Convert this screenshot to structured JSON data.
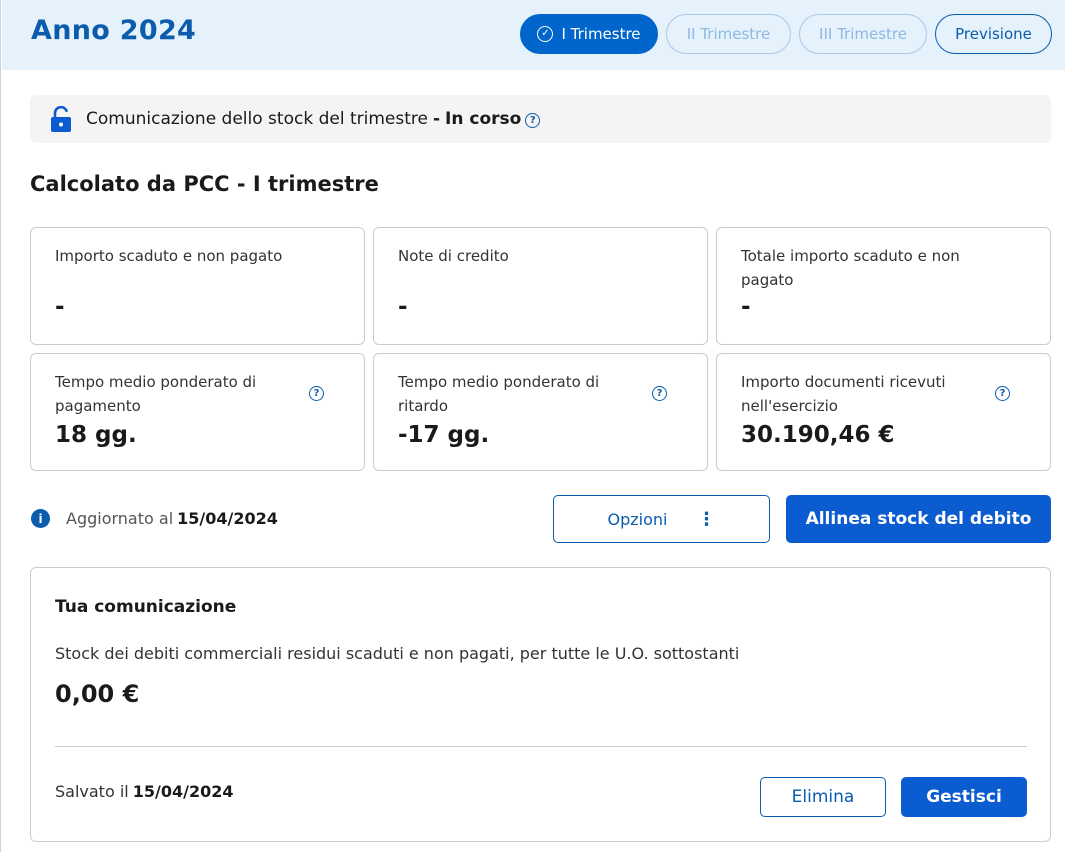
{
  "header": {
    "title": "Anno 2024",
    "tabs": [
      {
        "label": "I Trimestre",
        "state": "active"
      },
      {
        "label": "II Trimestre",
        "state": "disabled"
      },
      {
        "label": "III Trimestre",
        "state": "disabled"
      },
      {
        "label": "Previsione",
        "state": "enabled"
      }
    ]
  },
  "status": {
    "label": "Comunicazione dello stock del trimestre",
    "separator": "-",
    "value": "In corso",
    "lock_icon": "lock-open-icon",
    "help_icon": "?"
  },
  "section": {
    "title": "Calcolato da PCC - I trimestre"
  },
  "cards": [
    {
      "label": "Importo scaduto e non pagato",
      "value": "-"
    },
    {
      "label": "Note di credito",
      "value": "-"
    },
    {
      "label": "Totale importo scaduto e non pagato",
      "value": "-"
    },
    {
      "label": "Tempo medio ponderato di pagamento",
      "value": "18 gg.",
      "help": "?"
    },
    {
      "label": "Tempo medio ponderato di ritardo",
      "value": "-17 gg.",
      "help": "?"
    },
    {
      "label": "Importo documenti ricevuti nell'esercizio",
      "value": "30.190,46 €",
      "help": "?"
    }
  ],
  "update": {
    "info_icon": "i",
    "label": "Aggiornato al",
    "date": "15/04/2024"
  },
  "actions": {
    "options_label": "Opzioni",
    "kebab": "⋮",
    "align_label": "Allinea stock del debito"
  },
  "communication": {
    "title": "Tua comunicazione",
    "description": "Stock dei debiti commerciali residui scaduti e non pagati, per tutte le U.O. sottostanti",
    "amount": "0,00 €",
    "saved_label": "Salvato il",
    "saved_date": "15/04/2024",
    "delete_label": "Elimina",
    "manage_label": "Gestisci"
  },
  "colors": {
    "primary": "#0b5cad",
    "button_blue": "#0b5cd0",
    "header_bg": "#e5f1fb",
    "status_bg": "#f4f4f5",
    "border": "#c9cdd2"
  }
}
